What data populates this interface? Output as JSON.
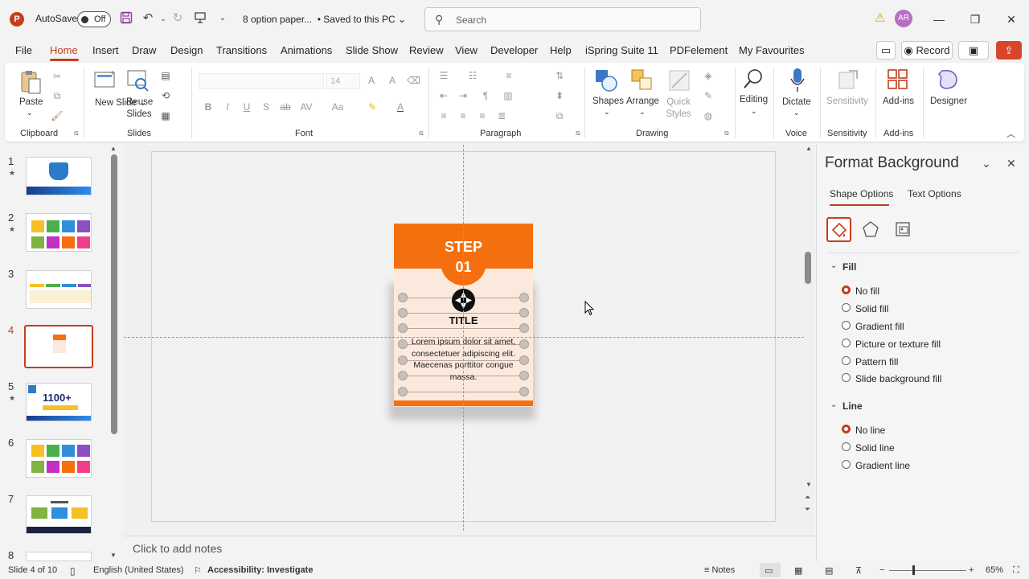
{
  "titlebar": {
    "autosave_label": "AutoSave",
    "autosave_state": "Off",
    "doc_name": "8 option paper...",
    "save_status": "• Saved to this PC",
    "search_placeholder": "Search",
    "user_initials": "AR"
  },
  "menu": {
    "items": [
      "File",
      "Home",
      "Insert",
      "Draw",
      "Design",
      "Transitions",
      "Animations",
      "Slide Show",
      "Review",
      "View",
      "Developer",
      "Help",
      "iSpring Suite 11",
      "PDFelement",
      "My Favourites"
    ],
    "active": "Home",
    "record_label": "Record"
  },
  "ribbon": {
    "paste_label": "Paste",
    "new_slide_label": "New Slide",
    "reuse_slides_label": "Reuse Slides",
    "font_size": "14",
    "shapes_label": "Shapes",
    "arrange_label": "Arrange",
    "quick_styles_label": "Quick Styles",
    "editing_label": "Editing",
    "dictate_label": "Dictate",
    "sensitivity_label": "Sensitivity",
    "addins_label": "Add-ins",
    "designer_label": "Designer",
    "groups": {
      "clipboard": "Clipboard",
      "slides": "Slides",
      "font": "Font",
      "paragraph": "Paragraph",
      "drawing": "Drawing",
      "voice": "Voice",
      "sensitivity": "Sensitivity",
      "addins": "Add-ins"
    }
  },
  "thumbnails": {
    "numbers": [
      "1",
      "2",
      "3",
      "4",
      "5",
      "6",
      "7",
      "8"
    ],
    "active_index": 4,
    "slide5_text": "1100+"
  },
  "slide": {
    "step_line1": "STEP",
    "step_line2": "01",
    "title": "TITLE",
    "body": "Lorem ipsum dolor sit amet, consectetuer adipiscing elit. Maecenas porttitor congue massa.",
    "accent_color": "#f4700f",
    "card_bg": "#fce9de"
  },
  "notes": {
    "placeholder": "Click to add notes"
  },
  "status": {
    "slide_info": "Slide 4 of 10",
    "language": "English (United States)",
    "accessibility": "Accessibility: Investigate",
    "notes_label": "Notes",
    "zoom": "65%"
  },
  "format_panel": {
    "title": "Format Background",
    "tabs": [
      "Shape Options",
      "Text Options"
    ],
    "fill_header": "Fill",
    "fill_options": [
      "No fill",
      "Solid fill",
      "Gradient fill",
      "Picture or texture fill",
      "Pattern fill",
      "Slide background fill"
    ],
    "fill_selected": "No fill",
    "line_header": "Line",
    "line_options": [
      "No line",
      "Solid line",
      "Gradient line"
    ],
    "line_selected": "No line"
  },
  "colors": {
    "brand": "#c43e1c",
    "warning": "#e8a200"
  }
}
